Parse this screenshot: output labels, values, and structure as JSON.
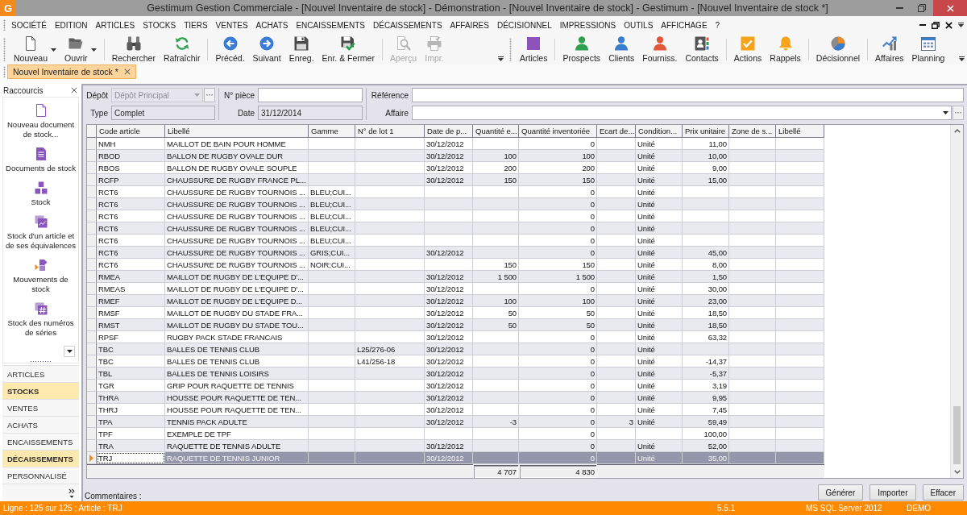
{
  "window": {
    "icon_letter": "G",
    "title": "Gestimum Gestion Commerciale - [Nouvel Inventaire de stock] - Démonstration - [Nouvel Inventaire de stock] - Gestimum - [Nouvel Inventaire de stock *]"
  },
  "menu": [
    "SOCIÉTÉ",
    "EDITION",
    "ARTICLES",
    "STOCKS",
    "TIERS",
    "VENTES",
    "ACHATS",
    "ENCAISSEMENTS",
    "DÉCAISSEMENTS",
    "AFFAIRES",
    "DÉCISIONNEL",
    "IMPRESSIONS",
    "OUTILS",
    "AFFICHAGE",
    "?"
  ],
  "toolbars": [
    {
      "groups": [
        [
          {
            "label": "Nouveau",
            "dropdown": true,
            "disabled": false
          },
          {
            "label": "Ouvrir",
            "dropdown": true,
            "disabled": false
          }
        ],
        [
          {
            "label": "Rechercher",
            "dropdown": false,
            "disabled": false
          },
          {
            "label": "Rafraîchir",
            "dropdown": false,
            "disabled": false
          }
        ],
        [
          {
            "label": "Précéd.",
            "dropdown": false,
            "disabled": false
          },
          {
            "label": "Suivant",
            "dropdown": false,
            "disabled": false
          },
          {
            "label": "Enreg.",
            "dropdown": false,
            "disabled": false
          },
          {
            "label": "Enr. & Fermer",
            "dropdown": false,
            "disabled": false
          }
        ],
        [
          {
            "label": "Aperçu",
            "dropdown": false,
            "disabled": true
          },
          {
            "label": "Impr.",
            "dropdown": false,
            "disabled": true
          }
        ]
      ]
    },
    {
      "groups": [
        [
          {
            "label": "Articles",
            "dropdown": false,
            "disabled": false
          }
        ],
        [
          {
            "label": "Prospects",
            "dropdown": false,
            "disabled": false
          },
          {
            "label": "Clients",
            "dropdown": false,
            "disabled": false
          },
          {
            "label": "Fourniss.",
            "dropdown": false,
            "disabled": false
          },
          {
            "label": "Contacts",
            "dropdown": false,
            "disabled": false
          }
        ],
        [
          {
            "label": "Actions",
            "dropdown": false,
            "disabled": false
          },
          {
            "label": "Rappels",
            "dropdown": false,
            "disabled": false
          }
        ],
        [
          {
            "label": "Décisionnel",
            "dropdown": false,
            "disabled": false
          }
        ],
        [
          {
            "label": "Affaires",
            "dropdown": false,
            "disabled": false
          },
          {
            "label": "Planning",
            "dropdown": false,
            "disabled": false
          }
        ]
      ]
    }
  ],
  "document_tabs": [
    {
      "label": "Nouvel Inventaire de stock *",
      "selected": true
    }
  ],
  "shortcuts": {
    "title": "Raccourcis",
    "items": [
      "Nouveau document de stock...",
      "Documents de stock",
      "Stock",
      "Stock d'un article et de ses équivalences",
      "Mouvements de stock",
      "Stock des numéros de séries"
    ]
  },
  "modules": [
    {
      "label": "ARTICLES",
      "selected": false
    },
    {
      "label": "STOCKS",
      "selected": true
    },
    {
      "label": "VENTES",
      "selected": false
    },
    {
      "label": "ACHATS",
      "selected": false
    },
    {
      "label": "ENCAISSEMENTS",
      "selected": false
    },
    {
      "label": "DÉCAISSEMENTS",
      "selected": true
    },
    {
      "label": "PERSONNALISÉ",
      "selected": false
    }
  ],
  "form": {
    "depot": {
      "label": "Dépôt",
      "value": "Dépôt Principal",
      "disabled": true
    },
    "type": {
      "label": "Type",
      "value": "Complet",
      "readonly": true
    },
    "numero_piece": {
      "label": "N° pièce"
    },
    "date": {
      "label": "Date",
      "value": "31/12/2014",
      "readonly": true
    },
    "reference": {
      "label": "Référence"
    },
    "affaire": {
      "label": "Affaire"
    }
  },
  "table": {
    "columns": [
      "Code article",
      "Libellé",
      "Gamme",
      "N° de lot 1",
      "Date de p...",
      "Quantité e...",
      "Quantité inventoriée",
      "Ecart de...",
      "Condition...",
      "Prix unitaire",
      "Zone de s...",
      "Libellé"
    ],
    "rows": [
      {
        "selected": false,
        "cells": [
          "NMH",
          "MAILLOT DE BAIN POUR HOMME",
          null,
          null,
          "30/12/2012",
          null,
          "0",
          null,
          "Unité",
          "11,00"
        ]
      },
      {
        "selected": false,
        "cells": [
          "RBOD",
          "BALLON DE RUGBY OVALE DUR",
          null,
          null,
          "30/12/2012",
          "100",
          "100",
          null,
          "Unité",
          "10,00"
        ]
      },
      {
        "selected": false,
        "cells": [
          "RBOS",
          "BALLON DE RUGBY OVALE SOUPLE",
          null,
          null,
          "30/12/2012",
          "200",
          "200",
          null,
          "Unité",
          "9,00"
        ]
      },
      {
        "selected": false,
        "cells": [
          "RCFP",
          "CHAUSSURE DE RUGBY FRANCE PL...",
          null,
          null,
          "30/12/2012",
          "150",
          "150",
          null,
          "Unité",
          "15,00"
        ]
      },
      {
        "selected": false,
        "cells": [
          "RCT6",
          "CHAUSSURE DE RUGBY TOURNOIS ...",
          "BLEU;CUI...",
          null,
          null,
          null,
          "0",
          null,
          "Unité"
        ]
      },
      {
        "selected": false,
        "cells": [
          "RCT6",
          "CHAUSSURE DE RUGBY TOURNOIS ...",
          "BLEU;CUI...",
          null,
          null,
          null,
          "0",
          null,
          "Unité"
        ]
      },
      {
        "selected": false,
        "cells": [
          "RCT6",
          "CHAUSSURE DE RUGBY TOURNOIS ...",
          "BLEU;CUI...",
          null,
          null,
          null,
          "0",
          null,
          "Unité"
        ]
      },
      {
        "selected": false,
        "cells": [
          "RCT6",
          "CHAUSSURE DE RUGBY TOURNOIS ...",
          "BLEU;CUI...",
          null,
          null,
          null,
          "0",
          null,
          "Unité"
        ]
      },
      {
        "selected": false,
        "cells": [
          "RCT6",
          "CHAUSSURE DE RUGBY TOURNOIS ...",
          "BLEU;CUI...",
          null,
          null,
          null,
          "0",
          null,
          "Unité"
        ]
      },
      {
        "selected": false,
        "cells": [
          "RCT6",
          "CHAUSSURE DE RUGBY TOURNOIS ...",
          "GRIS;CUI...",
          null,
          "30/12/2012",
          null,
          "0",
          null,
          "Unité",
          "45,00"
        ]
      },
      {
        "selected": false,
        "cells": [
          "RCT6",
          "CHAUSSURE DE RUGBY TOURNOIS ...",
          "NOIR;CUI...",
          null,
          null,
          "150",
          "150",
          null,
          "Unité",
          "8,00"
        ]
      },
      {
        "selected": false,
        "cells": [
          "RMEA",
          "MAILLOT DE RUGBY DE L'EQUIPE D'...",
          null,
          null,
          "30/12/2012",
          "1 500",
          "1 500",
          null,
          "Unité",
          "1,50"
        ]
      },
      {
        "selected": false,
        "cells": [
          "RMEAS",
          "MAILLOT DE RUGBY DE L'EQUIPE D'...",
          null,
          null,
          "30/12/2012",
          null,
          "0",
          null,
          "Unité",
          "30,00"
        ]
      },
      {
        "selected": false,
        "cells": [
          "RMEF",
          "MAILLOT DE RUGBY DE L'EQUIPE D...",
          null,
          null,
          "30/12/2012",
          "100",
          "100",
          null,
          "Unité",
          "23,00"
        ]
      },
      {
        "selected": false,
        "cells": [
          "RMSF",
          "MAILLOT DE RUGBY DU STADE FRA...",
          null,
          null,
          "30/12/2012",
          "50",
          "50",
          null,
          "Unité",
          "18,50"
        ]
      },
      {
        "selected": false,
        "cells": [
          "RMST",
          "MAILLOT DE RUGBY DU STADE TOU...",
          null,
          null,
          "30/12/2012",
          "50",
          "50",
          null,
          "Unité",
          "18,50"
        ]
      },
      {
        "selected": false,
        "cells": [
          "RPSF",
          "RUGBY PACK STADE FRANCAIS",
          null,
          null,
          "30/12/2012",
          null,
          "0",
          null,
          "Unité",
          "63,32"
        ]
      },
      {
        "selected": false,
        "cells": [
          "TBC",
          "BALLES DE TENNIS CLUB",
          null,
          "L25/276-06",
          "30/12/2012",
          null,
          "0",
          null,
          "Unité"
        ]
      },
      {
        "selected": false,
        "cells": [
          "TBC",
          "BALLES DE TENNIS CLUB",
          null,
          "L41/256-18",
          "30/12/2012",
          null,
          "0",
          null,
          "Unité",
          "-14,37"
        ]
      },
      {
        "selected": false,
        "cells": [
          "TBL",
          "BALLES DE TENNIS LOISIRS",
          null,
          null,
          "30/12/2012",
          null,
          "0",
          null,
          "Unité",
          "-5,37"
        ]
      },
      {
        "selected": false,
        "cells": [
          "TGR",
          "GRIP POUR RAQUETTE DE TENNIS",
          null,
          null,
          "30/12/2012",
          null,
          "0",
          null,
          "Unité",
          "3,19"
        ]
      },
      {
        "selected": false,
        "cells": [
          "THRA",
          "HOUSSE POUR RAQUETTE DE TEN...",
          null,
          null,
          "30/12/2012",
          null,
          "0",
          null,
          "Unité",
          "9,95"
        ]
      },
      {
        "selected": false,
        "cells": [
          "THRJ",
          "HOUSSE POUR RAQUETTE DE TEN...",
          null,
          null,
          "30/12/2012",
          null,
          "0",
          null,
          "Unité",
          "7,45"
        ]
      },
      {
        "selected": false,
        "cells": [
          "TPA",
          "TENNIS PACK ADULTE",
          null,
          null,
          "30/12/2012",
          "-3",
          "0",
          "3",
          "Unité",
          "59,49"
        ]
      },
      {
        "selected": false,
        "cells": [
          "TPF",
          "EXEMPLE DE TPF",
          null,
          null,
          null,
          null,
          "0",
          null,
          null,
          "100,00"
        ]
      },
      {
        "selected": false,
        "cells": [
          "TRA",
          "RAQUETTE DE TENNIS ADULTE",
          null,
          null,
          "30/12/2012",
          null,
          "0",
          null,
          "Unité",
          "52,00"
        ]
      },
      {
        "selected": true,
        "cells": [
          "TRJ",
          "RAQUETTE DE TENNIS JUNIOR",
          null,
          null,
          "30/12/2012",
          null,
          "0",
          null,
          "Unité",
          "35,00"
        ]
      }
    ],
    "totals": {
      "quantite_e": "4 707",
      "quantite_inventoriee": "4 830"
    }
  },
  "comments_label": "Commentaires :",
  "buttons": [
    "Générer",
    "Importer",
    "Effacer"
  ],
  "status_bar": {
    "position": "Ligne : 125 sur 125 ; Article : TRJ",
    "version": "5.5.1",
    "database": "MS SQL Server 2012",
    "mode": "DEMO"
  }
}
